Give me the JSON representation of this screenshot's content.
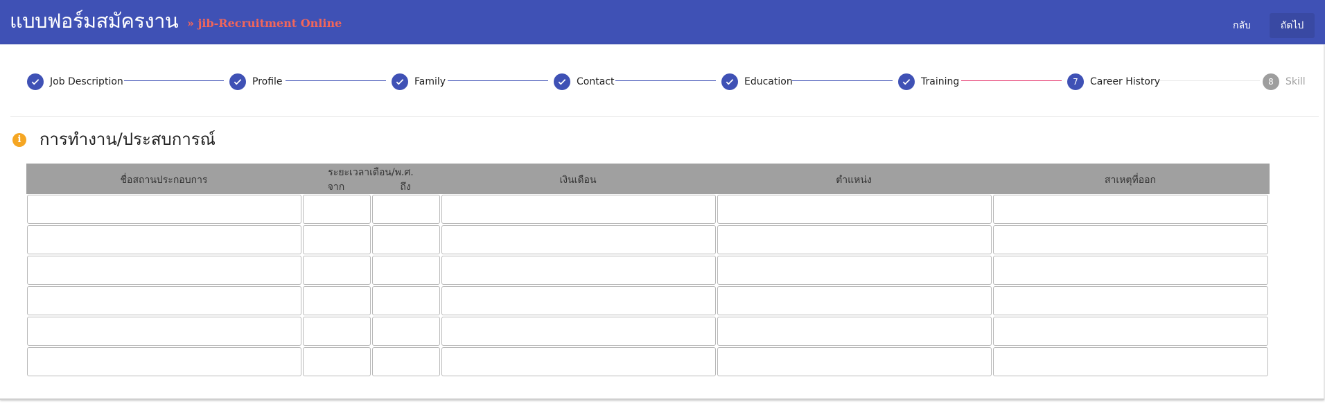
{
  "header": {
    "title": "แบบฟอร์มสมัครงาน",
    "subtitle": "» jib-Recruitment Online",
    "back_label": "กลับ",
    "next_label": "ถัดไป"
  },
  "stepper": {
    "steps": [
      {
        "label": "Job Description",
        "state": "done"
      },
      {
        "label": "Profile",
        "state": "done"
      },
      {
        "label": "Family",
        "state": "done"
      },
      {
        "label": "Contact",
        "state": "done"
      },
      {
        "label": "Education",
        "state": "done"
      },
      {
        "label": "Training",
        "state": "done"
      },
      {
        "label": "Career History",
        "state": "current",
        "number": "7"
      },
      {
        "label": "Skill",
        "state": "pending",
        "number": "8"
      }
    ]
  },
  "section": {
    "title": "การทำงาน/ประสบการณ์"
  },
  "table": {
    "headers": {
      "company": "ชื่อสถานประกอบการ",
      "period": "ระยะเวลาเดือน/พ.ศ.",
      "from": "จาก",
      "to": "ถึง",
      "salary": "เงินเดือน",
      "position": "ตำแหน่ง",
      "reason": "สาเหตุที่ออก"
    },
    "rows": [
      {
        "company": "",
        "from": "",
        "to": "",
        "salary": "",
        "position": "",
        "reason": ""
      },
      {
        "company": "",
        "from": "",
        "to": "",
        "salary": "",
        "position": "",
        "reason": ""
      },
      {
        "company": "",
        "from": "",
        "to": "",
        "salary": "",
        "position": "",
        "reason": ""
      },
      {
        "company": "",
        "from": "",
        "to": "",
        "salary": "",
        "position": "",
        "reason": ""
      },
      {
        "company": "",
        "from": "",
        "to": "",
        "salary": "",
        "position": "",
        "reason": ""
      },
      {
        "company": "",
        "from": "",
        "to": "",
        "salary": "",
        "position": "",
        "reason": ""
      }
    ]
  },
  "colors": {
    "primary": "#3f51b5",
    "accent_title": "#f2665a",
    "active_connector": "#e5386d",
    "pending": "#9e9e9e",
    "info": "#f5a623"
  }
}
